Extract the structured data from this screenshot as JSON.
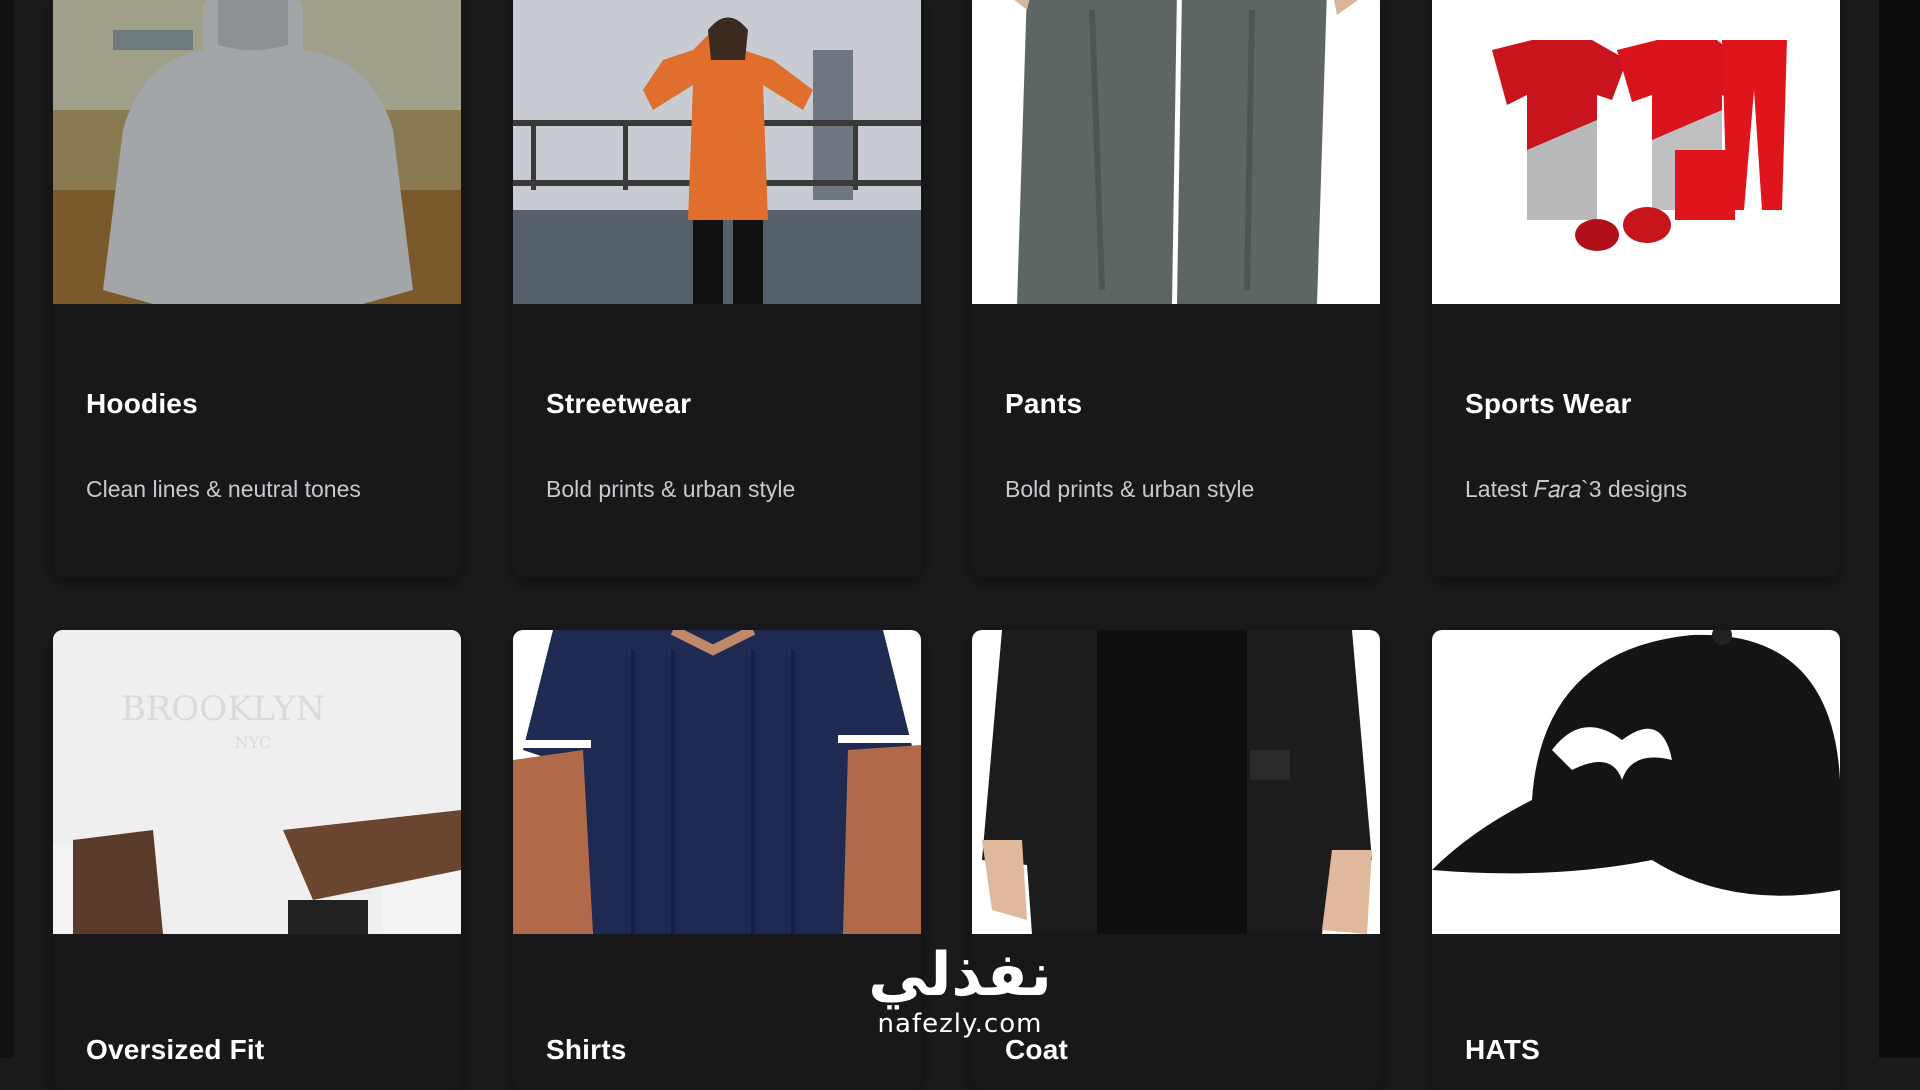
{
  "categories": [
    {
      "title": "Hoodies",
      "desc": "Clean lines & neutral tones"
    },
    {
      "title": "Streetwear",
      "desc": "Bold prints & urban style"
    },
    {
      "title": "Pants",
      "desc": "Bold prints & urban style"
    },
    {
      "title": "Sports Wear",
      "desc": "Latest 𝐹𝑎𝑟𝑎`3 designs"
    },
    {
      "title": "Oversized Fit",
      "desc": ""
    },
    {
      "title": "Shirts",
      "desc": ""
    },
    {
      "title": "Coat",
      "desc": ""
    },
    {
      "title": "HATS",
      "desc": ""
    }
  ],
  "watermark": {
    "arabic": "نفذلي",
    "latin": "nafezly.com"
  }
}
